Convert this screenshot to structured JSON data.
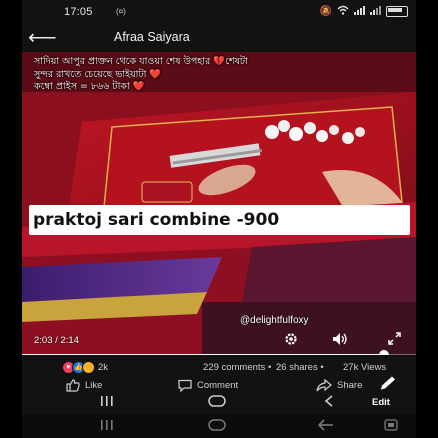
{
  "status_bar": {
    "time": "17:05",
    "vpn_indicator": "(¤)",
    "icons": [
      "mute-icon",
      "wifi-icon",
      "signal-icon",
      "signal-icon",
      "battery-icon"
    ]
  },
  "header": {
    "title": "Afraa Saiyara"
  },
  "video": {
    "caption_lines": [
      "সাদিয়া আপুর প্রাক্তন থেকে যাওয়া শেষ উপহার 💔শেষটা",
      "সুন্দর রাখতে চেয়েছে ভাইয়াটা ❤️",
      "কম্বো প্রাইস = ৮৬৬ টাকা ❤️"
    ],
    "banner_text": "praktoj sari combine  -900",
    "watermark": "@delightfulfoxy",
    "current_time": "2:03",
    "duration": "2:14",
    "time_display": "2:03 / 2:14",
    "progress_fraction": 0.918
  },
  "stats": {
    "reaction_count": "2k",
    "comments": "229 comments",
    "separator": "•",
    "shares": "26 shares",
    "views": "27k Views"
  },
  "actions": {
    "like_label": "Like",
    "comment_label": "Comment",
    "share_label": "Share"
  },
  "bottom_nav": {
    "edit_label": "Edit"
  },
  "colors": {
    "background": "#121212",
    "video_red": "#a4121f",
    "like_blue": "#1877f2",
    "heart_red": "#f33e58",
    "haha_yellow": "#f7b125"
  }
}
